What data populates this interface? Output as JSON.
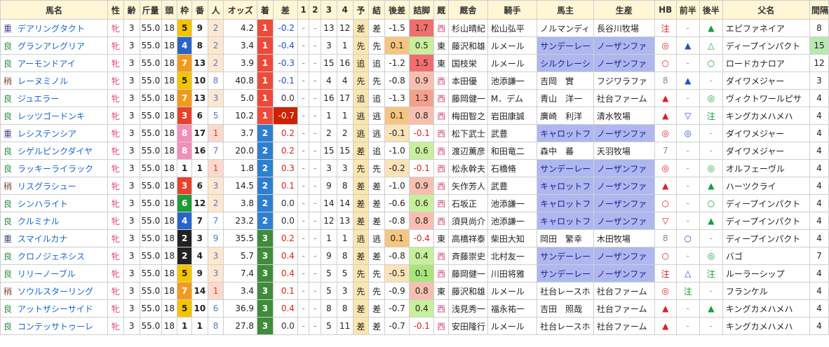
{
  "colors": {
    "header_bg": "#fff6d5",
    "chaku_1": "#ee4a3a",
    "chaku_2": "#2f7fd0",
    "chaku_3": "#3f8c3a",
    "diff_neg_bg": "#cc2200",
    "hi_blue": "#aeb8ee"
  },
  "headers": [
    "馬名",
    "性",
    "齢",
    "斤量",
    "頭",
    "枠",
    "番",
    "人",
    "オッズ",
    "着",
    "差",
    "1",
    "2",
    "3",
    "4",
    "予",
    "結",
    "後差",
    "詰脚",
    "厩",
    "厩舎",
    "騎手",
    "馬主",
    "生産",
    "HB",
    "前半",
    "後半",
    "父名",
    "間隔"
  ],
  "rows": [
    {
      "baba": "重",
      "name": "デアリングタクト",
      "sex": "牝",
      "age": "3",
      "kin": "55.0",
      "to": "18",
      "waku": "5",
      "ban": "9",
      "ninki": "2",
      "odds": "4.2",
      "chaku": "1",
      "sa": "-0.2",
      "c1": "-",
      "c2": "-",
      "c3": "13",
      "c4": "12",
      "yo": "差",
      "ketsu": "差",
      "kosa": "-1.5",
      "tsume": "1.7",
      "kyu": "西",
      "trainer": "杉山晴紀",
      "jockey": "松山弘平",
      "owner": "ノルマンディ",
      "breeder": "長谷川牧場",
      "hb": "注",
      "zen": "-",
      "kou": "▲",
      "sire": "エピファネイア",
      "interval": "8"
    },
    {
      "baba": "良",
      "name": "グランアレグリア",
      "sex": "牝",
      "age": "3",
      "kin": "55.0",
      "to": "18",
      "waku": "4",
      "ban": "8",
      "ninki": "2",
      "odds": "3.4",
      "chaku": "1",
      "sa": "-0.4",
      "c1": "-",
      "c2": "-",
      "c3": "3",
      "c4": "1",
      "yo": "先",
      "ketsu": "先",
      "kosa": "0.1",
      "tsume": "0.5",
      "kyu": "東",
      "trainer": "藤沢和雄",
      "jockey": "ルメール",
      "owner": "サンデーレー",
      "breeder": "ノーザンファ",
      "hb": "◎",
      "zen": "▲",
      "kou": "△",
      "sire": "ディープインパクト",
      "interval": "15"
    },
    {
      "baba": "良",
      "name": "アーモンドアイ",
      "sex": "牝",
      "age": "3",
      "kin": "55.0",
      "to": "18",
      "waku": "7",
      "ban": "13",
      "ninki": "2",
      "odds": "3.9",
      "chaku": "1",
      "sa": "-0.3",
      "c1": "-",
      "c2": "-",
      "c3": "15",
      "c4": "16",
      "yo": "追",
      "ketsu": "追",
      "kosa": "-1.2",
      "tsume": "1.5",
      "kyu": "東",
      "trainer": "国枝栄",
      "jockey": "ルメール",
      "owner": "シルクレーシ",
      "breeder": "ノーザンファ",
      "hb": "○",
      "zen": "-",
      "kou": "○",
      "sire": "ロードカナロア",
      "interval": "12"
    },
    {
      "baba": "稍",
      "name": "レーヌミノル",
      "sex": "牝",
      "age": "3",
      "kin": "55.0",
      "to": "18",
      "waku": "5",
      "ban": "10",
      "ninki": "8",
      "odds": "40.8",
      "chaku": "1",
      "sa": "-0.1",
      "c1": "-",
      "c2": "-",
      "c3": "4",
      "c4": "4",
      "yo": "先",
      "ketsu": "先",
      "kosa": "-0.8",
      "tsume": "0.9",
      "kyu": "西",
      "trainer": "本田優",
      "jockey": "池添謙一",
      "owner": "吉岡　實",
      "breeder": "フジワラファ",
      "hb": "8",
      "zen": "▲",
      "kou": "-",
      "sire": "ダイワメジャー",
      "interval": "3"
    },
    {
      "baba": "良",
      "name": "ジュエラー",
      "sex": "牝",
      "age": "3",
      "kin": "55.0",
      "to": "18",
      "waku": "7",
      "ban": "13",
      "ninki": "3",
      "odds": "5.0",
      "chaku": "1",
      "sa": "0.0",
      "c1": "-",
      "c2": "-",
      "c3": "16",
      "c4": "17",
      "yo": "追",
      "ketsu": "追",
      "kosa": "-1.3",
      "tsume": "1.3",
      "kyu": "西",
      "trainer": "藤岡健一",
      "jockey": "M．デム",
      "owner": "青山　洋一",
      "breeder": "社台ファーム",
      "hb": "▲",
      "zen": "-",
      "kou": "◎",
      "sire": "ヴィクトワールピサ",
      "interval": "4"
    },
    {
      "baba": "良",
      "name": "レッツゴードンキ",
      "sex": "牝",
      "age": "3",
      "kin": "55.0",
      "to": "18",
      "waku": "3",
      "ban": "6",
      "ninki": "5",
      "odds": "10.2",
      "chaku": "1",
      "sa": "-0.7",
      "c1": "-",
      "c2": "-",
      "c3": "1",
      "c4": "1",
      "yo": "逃",
      "ketsu": "逃",
      "kosa": "0.1",
      "tsume": "0.8",
      "kyu": "西",
      "trainer": "梅田智之",
      "jockey": "岩田康誠",
      "owner": "廣崎　利洋",
      "breeder": "清水牧場",
      "hb": "▲",
      "zen": "▽",
      "kou": "注",
      "sire": "キングカメハメハ",
      "interval": "4"
    },
    {
      "baba": "重",
      "name": "レシステンシア",
      "sex": "牝",
      "age": "3",
      "kin": "55.0",
      "to": "18",
      "waku": "8",
      "ban": "17",
      "ninki": "1",
      "odds": "3.7",
      "chaku": "2",
      "sa": "0.2",
      "c1": "-",
      "c2": "-",
      "c3": "2",
      "c4": "2",
      "yo": "逃",
      "ketsu": "逃",
      "kosa": "-0.1",
      "tsume": "-0.1",
      "kyu": "西",
      "trainer": "松下武士",
      "jockey": "武豊",
      "owner": "キャロットフ",
      "breeder": "ノーザンファ",
      "hb": "◎",
      "zen": "◎",
      "kou": "-",
      "sire": "ダイワメジャー",
      "interval": "4"
    },
    {
      "baba": "良",
      "name": "シゲルピンクダイヤ",
      "sex": "牝",
      "age": "3",
      "kin": "55.0",
      "to": "18",
      "waku": "8",
      "ban": "16",
      "ninki": "7",
      "odds": "20.0",
      "chaku": "2",
      "sa": "0.2",
      "c1": "-",
      "c2": "-",
      "c3": "15",
      "c4": "15",
      "yo": "差",
      "ketsu": "追",
      "kosa": "-1.0",
      "tsume": "0.6",
      "kyu": "西",
      "trainer": "渡辺薫彦",
      "jockey": "和田竜二",
      "owner": "森中　蕃",
      "breeder": "天羽牧場",
      "hb": "7",
      "zen": "-",
      "kou": "-",
      "sire": "ダイワメジャー",
      "interval": "4"
    },
    {
      "baba": "良",
      "name": "ラッキーライラック",
      "sex": "牝",
      "age": "3",
      "kin": "55.0",
      "to": "18",
      "waku": "1",
      "ban": "1",
      "ninki": "1",
      "odds": "1.8",
      "chaku": "2",
      "sa": "0.3",
      "c1": "-",
      "c2": "-",
      "c3": "3",
      "c4": "3",
      "yo": "先",
      "ketsu": "先",
      "kosa": "-0.2",
      "tsume": "-0.1",
      "kyu": "西",
      "trainer": "松永幹夫",
      "jockey": "石橋脩",
      "owner": "サンデーレー",
      "breeder": "ノーザンファ",
      "hb": "◎",
      "zen": "-",
      "kou": "◎",
      "sire": "オルフェーヴル",
      "interval": "4"
    },
    {
      "baba": "稍",
      "name": "リスグラシュー",
      "sex": "牝",
      "age": "3",
      "kin": "55.0",
      "to": "18",
      "waku": "3",
      "ban": "6",
      "ninki": "3",
      "odds": "14.5",
      "chaku": "2",
      "sa": "0.1",
      "c1": "-",
      "c2": "-",
      "c3": "9",
      "c4": "8",
      "yo": "差",
      "ketsu": "差",
      "kosa": "-1.0",
      "tsume": "0.9",
      "kyu": "西",
      "trainer": "矢作芳人",
      "jockey": "武豊",
      "owner": "キャロットフ",
      "breeder": "ノーザンファ",
      "hb": "▲",
      "zen": "-",
      "kou": "▲",
      "sire": "ハーツクライ",
      "interval": "4"
    },
    {
      "baba": "良",
      "name": "シンハライト",
      "sex": "牝",
      "age": "3",
      "kin": "55.0",
      "to": "18",
      "waku": "6",
      "ban": "12",
      "ninki": "2",
      "odds": "3.8",
      "chaku": "2",
      "sa": "0.0",
      "c1": "-",
      "c2": "-",
      "c3": "14",
      "c4": "14",
      "yo": "差",
      "ketsu": "差",
      "kosa": "-0.6",
      "tsume": "0.6",
      "kyu": "西",
      "trainer": "石坂正",
      "jockey": "池添謙一",
      "owner": "キャロットフ",
      "breeder": "ノーザンファ",
      "hb": "○",
      "zen": "-",
      "kou": "○",
      "sire": "ディープインパクト",
      "interval": "4"
    },
    {
      "baba": "良",
      "name": "クルミナル",
      "sex": "牝",
      "age": "3",
      "kin": "55.0",
      "to": "18",
      "waku": "4",
      "ban": "7",
      "ninki": "7",
      "odds": "23.2",
      "chaku": "2",
      "sa": "0.0",
      "c1": "-",
      "c2": "-",
      "c3": "12",
      "c4": "13",
      "yo": "差",
      "ketsu": "差",
      "kosa": "-0.8",
      "tsume": "0.8",
      "kyu": "西",
      "trainer": "須貝尚介",
      "jockey": "池添謙一",
      "owner": "キャロットフ",
      "breeder": "ノーザンファ",
      "hb": "▽",
      "zen": "-",
      "kou": "▲",
      "sire": "ディープインパクト",
      "interval": "4"
    },
    {
      "baba": "重",
      "name": "スマイルカナ",
      "sex": "牝",
      "age": "3",
      "kin": "55.0",
      "to": "18",
      "waku": "2",
      "ban": "3",
      "ninki": "9",
      "odds": "35.5",
      "chaku": "3",
      "sa": "0.2",
      "c1": "-",
      "c2": "-",
      "c3": "1",
      "c4": "1",
      "yo": "逃",
      "ketsu": "逃",
      "kosa": "0.1",
      "tsume": "-0.4",
      "kyu": "東",
      "trainer": "高橋祥泰",
      "jockey": "柴田大知",
      "owner": "岡田　繁幸",
      "breeder": "木田牧場",
      "hb": "8",
      "zen": "○",
      "kou": "-",
      "sire": "ディープインパクト",
      "interval": "4"
    },
    {
      "baba": "良",
      "name": "クロノジェネシス",
      "sex": "牝",
      "age": "3",
      "kin": "55.0",
      "to": "18",
      "waku": "2",
      "ban": "4",
      "ninki": "3",
      "odds": "5.7",
      "chaku": "3",
      "sa": "0.4",
      "c1": "-",
      "c2": "-",
      "c3": "9",
      "c4": "8",
      "yo": "差",
      "ketsu": "差",
      "kosa": "-0.8",
      "tsume": "0.4",
      "kyu": "西",
      "trainer": "斉藤崇史",
      "jockey": "北村友一",
      "owner": "サンデーレー",
      "breeder": "ノーザンファ",
      "hb": "○",
      "zen": "-",
      "kou": "◎",
      "sire": "バゴ",
      "interval": "7"
    },
    {
      "baba": "良",
      "name": "リリーノーブル",
      "sex": "牝",
      "age": "3",
      "kin": "55.0",
      "to": "18",
      "waku": "5",
      "ban": "9",
      "ninki": "3",
      "odds": "7.4",
      "chaku": "3",
      "sa": "0.4",
      "c1": "-",
      "c2": "-",
      "c3": "5",
      "c4": "5",
      "yo": "先",
      "ketsu": "先",
      "kosa": "-0.5",
      "tsume": "0.1",
      "kyu": "西",
      "trainer": "藤岡健一",
      "jockey": "川田将雅",
      "owner": "サンデーレー",
      "breeder": "ノーザンファ",
      "hb": "注",
      "zen": "△",
      "kou": "注",
      "sire": "ルーラーシップ",
      "interval": "4"
    },
    {
      "baba": "稍",
      "name": "ソウルスターリング",
      "sex": "牝",
      "age": "3",
      "kin": "55.0",
      "to": "18",
      "waku": "7",
      "ban": "14",
      "ninki": "1",
      "odds": "3.4",
      "chaku": "3",
      "sa": "0.1",
      "c1": "-",
      "c2": "-",
      "c3": "5",
      "c4": "3",
      "yo": "先",
      "ketsu": "先",
      "kosa": "-0.9",
      "tsume": "0.8",
      "kyu": "東",
      "trainer": "藤沢和雄",
      "jockey": "ルメール",
      "owner": "社台レースホ",
      "breeder": "社台ファーム",
      "hb": "◎",
      "zen": "注",
      "kou": "-",
      "sire": "フランケル",
      "interval": "4"
    },
    {
      "baba": "良",
      "name": "アットザシーサイド",
      "sex": "牝",
      "age": "3",
      "kin": "55.0",
      "to": "18",
      "waku": "5",
      "ban": "10",
      "ninki": "6",
      "odds": "36.9",
      "chaku": "3",
      "sa": "0.4",
      "c1": "-",
      "c2": "-",
      "c3": "8",
      "c4": "8",
      "yo": "差",
      "ketsu": "差",
      "kosa": "-0.7",
      "tsume": "0.4",
      "kyu": "西",
      "trainer": "浅見秀一",
      "jockey": "福永祐一",
      "owner": "吉田　照哉",
      "breeder": "社台ファーム",
      "hb": "▲",
      "zen": "-",
      "kou": "▲",
      "sire": "キングカメハメハ",
      "interval": "4"
    },
    {
      "baba": "良",
      "name": "コンテッサトゥーレ",
      "sex": "牝",
      "age": "3",
      "kin": "55.0",
      "to": "18",
      "waku": "1",
      "ban": "1",
      "ninki": "8",
      "odds": "27.8",
      "chaku": "3",
      "sa": "0.0",
      "c1": "-",
      "c2": "-",
      "c3": "5",
      "c4": "11",
      "yo": "差",
      "ketsu": "差",
      "kosa": "-0.7",
      "tsume": "-0.1",
      "kyu": "西",
      "trainer": "安田隆行",
      "jockey": "ルメール",
      "owner": "社台レースホ",
      "breeder": "社台ファーム",
      "hb": "▲",
      "zen": "-",
      "kou": "-",
      "sire": "キングカメハメハ",
      "interval": "4"
    }
  ]
}
